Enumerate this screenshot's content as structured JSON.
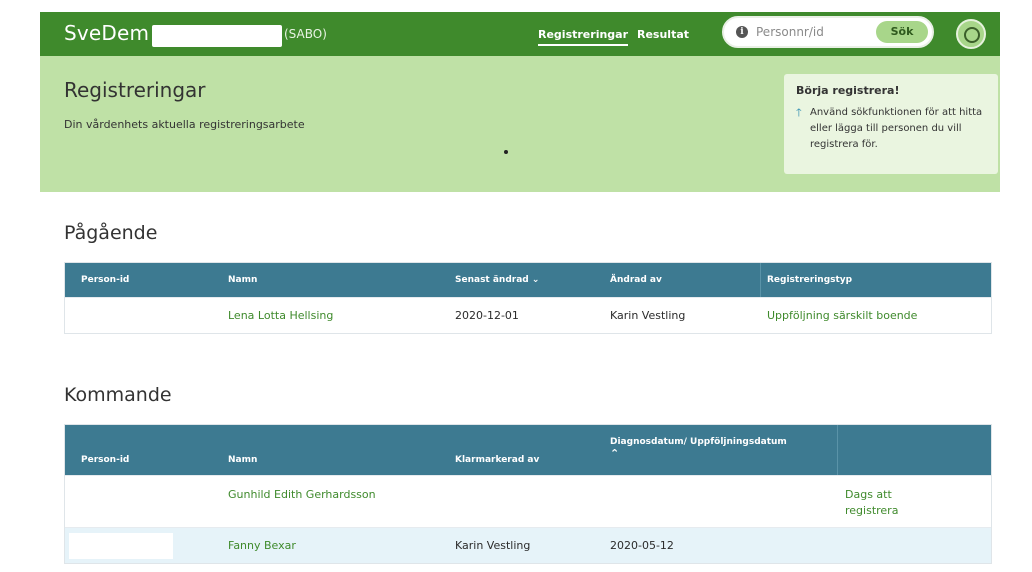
{
  "header": {
    "brand": "SveDem",
    "unit_code": "(SABO)",
    "nav": [
      "Registreringar",
      "Resultat"
    ],
    "search": {
      "placeholder": "Personnr/id",
      "button": "Sök"
    }
  },
  "hero": {
    "title": "Registreringar",
    "subtitle": "Din vårdenhets aktuella registreringsarbete",
    "hint": {
      "title": "Börja registrera!",
      "text": "Använd sökfunktionen för att hitta eller lägga till personen du vill registrera för."
    }
  },
  "ongoing": {
    "title": "Pågående",
    "columns": [
      "Person-id",
      "Namn",
      "Senast ändrad",
      "Ändrad av",
      "Registreringstyp"
    ],
    "rows": [
      {
        "person_id": "",
        "name": "Lena Lotta Hellsing",
        "changed": "2020-12-01",
        "changed_by": "Karin Vestling",
        "type": "Uppföljning särskilt boende"
      }
    ]
  },
  "upcoming": {
    "title": "Kommande",
    "columns": [
      "Person-id",
      "Namn",
      "Klarmarkerad av",
      "Diagnosdatum/ Uppföljningsdatum"
    ],
    "rows": [
      {
        "person_id": "",
        "name": "Gunhild Edith Gerhardsson",
        "marked_by": "",
        "date": "",
        "action": "Dags att registrera"
      },
      {
        "person_id": "",
        "name": "Fanny Bexar",
        "marked_by": "Karin Vestling",
        "date": "2020-05-12",
        "action": ""
      }
    ]
  },
  "colors": {
    "topbar": "#3f8a2c",
    "hero": "#bfe1a6",
    "table_header": "#3d7a91",
    "link": "#3f8a2c",
    "row_highlight": "#e6f3f9"
  }
}
